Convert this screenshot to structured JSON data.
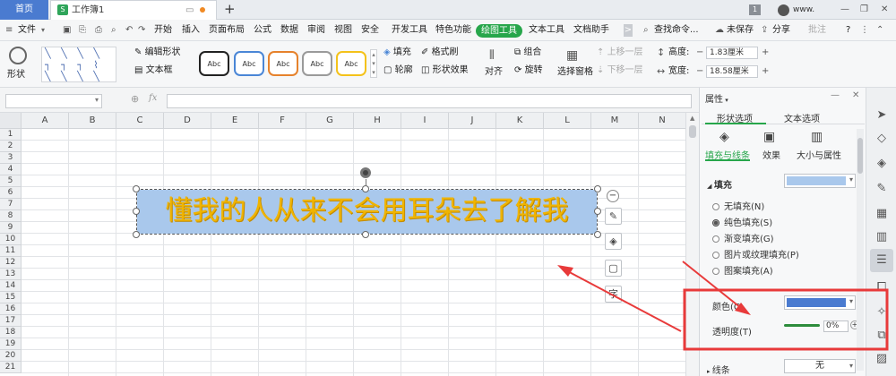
{
  "tabbar": {
    "home": "首页",
    "doc": "工作簿1",
    "doc_icon": "S",
    "plus": "+",
    "user": "www.",
    "badge": "1",
    "minimize": "—",
    "restore": "❐",
    "close": "✕"
  },
  "menus": [
    "开始",
    "插入",
    "页面布局",
    "公式",
    "数据",
    "审阅",
    "视图",
    "安全",
    "开发工具",
    "特色功能",
    "绘图工具",
    "文本工具",
    "文档助手"
  ],
  "menubar": {
    "file": "文件",
    "search": "查找命令...",
    "unsaved": "未保存",
    "share": "分享",
    "annotate": "批注",
    "help": "?",
    "more": ">"
  },
  "ribbon": {
    "shape": "形状",
    "edit_shape": "编辑形状",
    "text_box": "文本框",
    "styles": [
      "Abc",
      "Abc",
      "Abc",
      "Abc",
      "Abc"
    ],
    "fill": "填充",
    "format_brush": "格式刷",
    "outline": "轮廓",
    "shape_effect": "形状效果",
    "align": "对齐",
    "group": "组合",
    "rotate": "旋转",
    "select_pane": "选择窗格",
    "bring_forward": "上移一层",
    "send_backward": "下移一层",
    "height_label": "高度:",
    "height_value": "1.83厘米",
    "width_label": "宽度:",
    "width_value": "18.58厘米",
    "minus": "−",
    "plus": "+"
  },
  "formula": {
    "fx": "fx"
  },
  "columns": [
    "A",
    "B",
    "C",
    "D",
    "E",
    "F",
    "G",
    "H",
    "I",
    "J",
    "K",
    "L",
    "M",
    "N"
  ],
  "rows": [
    "1",
    "2",
    "3",
    "4",
    "5",
    "6",
    "7",
    "8",
    "9",
    "10",
    "11",
    "12",
    "13",
    "14",
    "15",
    "16",
    "17",
    "18",
    "19",
    "20",
    "21"
  ],
  "textbox": {
    "text": "懂我的人从来不会用耳朵去了解我",
    "text_color": "#f0b400",
    "fill_color": "#a9c8ec"
  },
  "panel": {
    "title": "属性",
    "tab_shape": "形状选项",
    "tab_text": "文本选项",
    "sub_fill": "填充与线条",
    "sub_effect": "效果",
    "sub_size": "大小与属性",
    "fill_header": "填充",
    "fill_options": [
      "无填充(N)",
      "纯色填充(S)",
      "渐变填充(G)",
      "图片或纹理填充(P)",
      "图案填充(A)"
    ],
    "selected_fill": 1,
    "color_label": "颜色(C)",
    "transparency_label": "透明度(T)",
    "transparency_value": "0%",
    "line_header": "线条",
    "line_value": "无",
    "fill_color": "#a9c8ec"
  },
  "colors": {
    "accent_green": "#27a64b",
    "home_blue": "#4a7bd0",
    "annotation_red": "#e83a3a"
  }
}
